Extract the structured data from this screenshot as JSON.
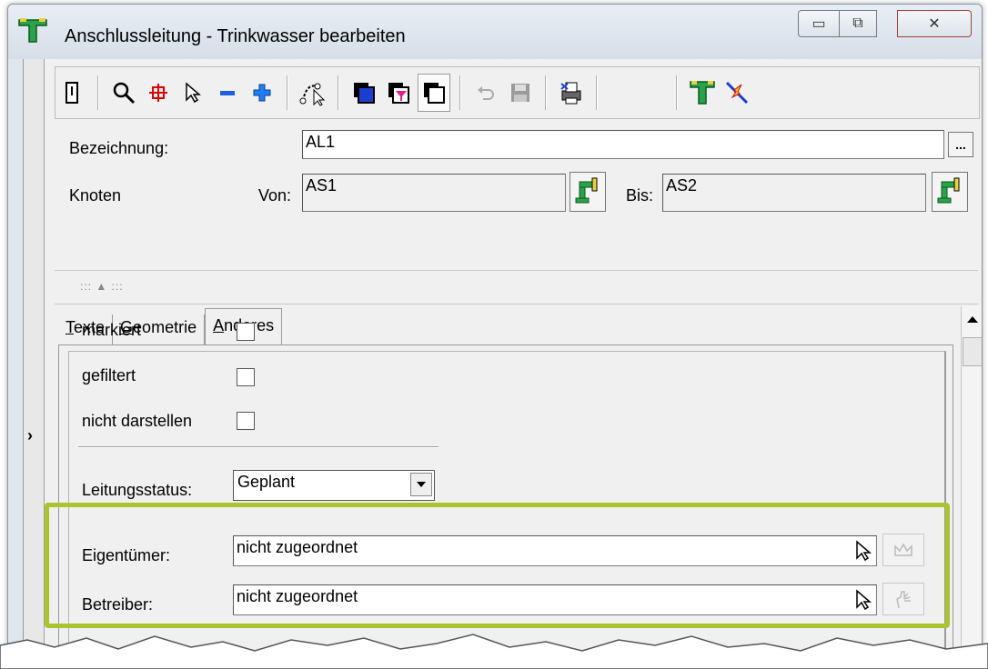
{
  "window": {
    "title": "Anschlussleitung - Trinkwasser bearbeiten",
    "controls": [
      "minimize",
      "maximize",
      "close"
    ]
  },
  "toolbar": {
    "buttons": [
      "properties-icon",
      "zoom-icon",
      "crosshair-icon",
      "pointer-icon",
      "minus-icon",
      "plus-icon",
      "route-icon",
      "layer-blue-icon",
      "layer-filter-icon",
      "layer-copy-icon",
      "undo-icon",
      "save-icon",
      "print-icon",
      "network-icon",
      "connect-icon"
    ]
  },
  "form": {
    "bezeichnung_label": "Bezeichnung:",
    "bezeichnung_value": "AL1",
    "browse_label": "...",
    "knoten_label": "Knoten",
    "von_label": "Von:",
    "von_value": "AS1",
    "bis_label": "Bis:",
    "bis_value": "AS2"
  },
  "gripper": ":::  ▲  :::",
  "tabs": [
    {
      "label_first": "T",
      "label_rest": "exte",
      "active": false
    },
    {
      "label_first": "G",
      "label_rest": "eometrie",
      "active": false
    },
    {
      "label_first": "A",
      "label_rest": "nderes",
      "active": true
    }
  ],
  "anderes": {
    "markiert_label": "markiert",
    "gefiltert_label": "gefiltert",
    "nicht_darstellen_label": "nicht darstellen",
    "leitungsstatus_label": "Leitungsstatus:",
    "leitungsstatus_value": "Geplant",
    "eigentuemer_label": "Eigentümer:",
    "eigentuemer_value": "nicht zugeordnet",
    "betreiber_label": "Betreiber:",
    "betreiber_value": "nicht zugeordnet"
  },
  "sidebar": {
    "expand_glyph": "›"
  },
  "colors": {
    "highlight": "#a9c42e",
    "titlebar": "#dfe6ee"
  }
}
